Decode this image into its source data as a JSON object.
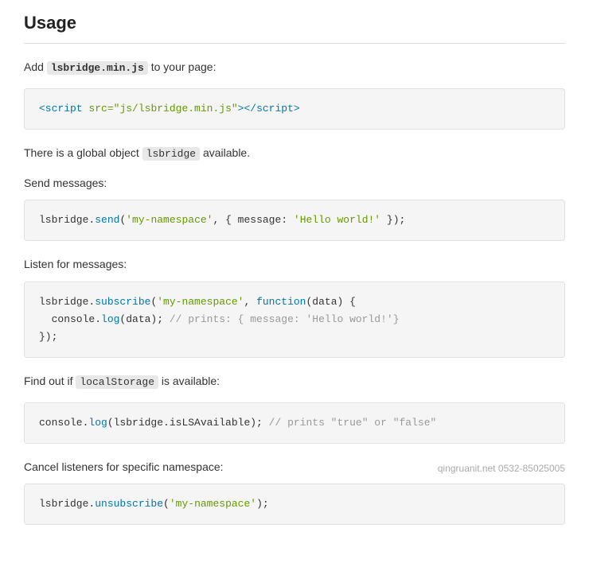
{
  "page": {
    "title": "Usage",
    "sections": [
      {
        "id": "add-script",
        "text_before": "Add ",
        "highlight": "lsbridge.min.js",
        "text_after": " to your page:",
        "code": "<script src=\"js/lsbridge.min.js\"></script>"
      },
      {
        "id": "global-object",
        "text_before": "There is a global object ",
        "highlight": "lsbridge",
        "text_after": " available."
      },
      {
        "id": "send-messages",
        "label": "Send messages:"
      },
      {
        "id": "send-code",
        "code_parts": [
          {
            "type": "plain",
            "text": "lsbridge."
          },
          {
            "type": "method",
            "text": "send"
          },
          {
            "type": "plain",
            "text": "("
          },
          {
            "type": "string",
            "text": "'my-namespace'"
          },
          {
            "type": "plain",
            "text": ", { message: "
          },
          {
            "type": "string",
            "text": "'Hello world!'"
          },
          {
            "type": "plain",
            "text": " });"
          }
        ]
      },
      {
        "id": "listen-messages",
        "label": "Listen for messages:"
      },
      {
        "id": "subscribe-code",
        "lines": [
          {
            "parts": [
              {
                "type": "plain",
                "text": "lsbridge."
              },
              {
                "type": "method",
                "text": "subscribe"
              },
              {
                "type": "plain",
                "text": "("
              },
              {
                "type": "string",
                "text": "'my-namespace'"
              },
              {
                "type": "plain",
                "text": ", "
              },
              {
                "type": "keyword",
                "text": "function"
              },
              {
                "type": "plain",
                "text": "(data) {"
              }
            ]
          },
          {
            "parts": [
              {
                "type": "plain",
                "text": "  console."
              },
              {
                "type": "method",
                "text": "log"
              },
              {
                "type": "plain",
                "text": "(data); "
              },
              {
                "type": "comment",
                "text": "// prints: { message: 'Hello world!'}"
              }
            ]
          },
          {
            "parts": [
              {
                "type": "plain",
                "text": "});"
              }
            ]
          }
        ]
      },
      {
        "id": "find-out",
        "text_before": "Find out if ",
        "highlight": "localStorage",
        "text_after": " is available:"
      },
      {
        "id": "isls-code",
        "code_parts": [
          {
            "type": "plain",
            "text": "console."
          },
          {
            "type": "method",
            "text": "log"
          },
          {
            "type": "plain",
            "text": "(lsbridge.isLSAvailable); "
          },
          {
            "type": "comment",
            "text": "// prints \"true\" or \"false\""
          }
        ]
      },
      {
        "id": "cancel-listeners",
        "label": "Cancel listeners for specific namespace:",
        "watermark": "qingruanit.net 0532-85025005"
      },
      {
        "id": "unsubscribe-code",
        "code_parts": [
          {
            "type": "plain",
            "text": "lsbridge."
          },
          {
            "type": "method",
            "text": "unsubscribe"
          },
          {
            "type": "plain",
            "text": "("
          },
          {
            "type": "string",
            "text": "'my-namespace'"
          },
          {
            "type": "plain",
            "text": ");"
          }
        ]
      }
    ]
  }
}
